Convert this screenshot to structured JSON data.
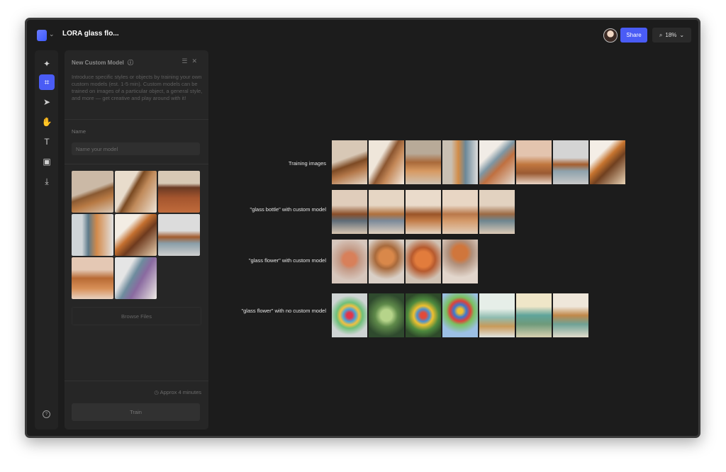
{
  "header": {
    "title": "LORA glass flo...",
    "share_label": "Share",
    "zoom": "18%",
    "zoom_icon": "search-icon",
    "brand_color": "#4a5cf5"
  },
  "toolbar": {
    "tools": [
      {
        "name": "sparkle-icon",
        "glyph": "✦"
      },
      {
        "name": "frame-tool-icon",
        "glyph": "⌗",
        "active": true
      },
      {
        "name": "select-pointer-icon",
        "glyph": "➤"
      },
      {
        "name": "hand-icon",
        "glyph": "✋"
      },
      {
        "name": "text-icon",
        "glyph": "T"
      },
      {
        "name": "image-add-icon",
        "glyph": "▣"
      },
      {
        "name": "download-icon",
        "glyph": "⤓"
      }
    ],
    "help_glyph": "?"
  },
  "panel": {
    "title": "New Custom Model",
    "info_glyph": "ⓘ",
    "description": "Introduce specific styles or objects by training your own custom models (est. 1-5 min). Custom models can be trained on images of a particular object, a general style, and more — get creative and play around with it!",
    "name_label": "Name",
    "name_placeholder": "Name your model",
    "browse_label": "Browse Files",
    "approx_label": "Approx 4 minutes",
    "train_label": "Train"
  },
  "canvas": {
    "rows": [
      {
        "label": "Training images",
        "count": 8
      },
      {
        "label": "\"glass bottle\" with custom model",
        "count": 5
      },
      {
        "label": "\"glass flower\" with custom model",
        "count": 4
      },
      {
        "label": "\"glass flower\" with no custom model",
        "count": 7
      }
    ]
  }
}
